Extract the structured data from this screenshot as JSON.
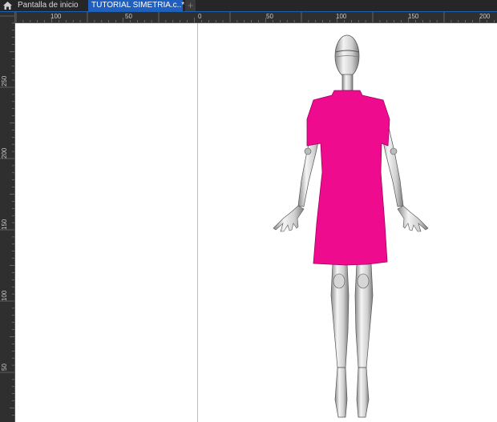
{
  "tabs": [
    {
      "label": "Pantalla de inicio",
      "active": false
    },
    {
      "label": "TUTORIAL SIMETRIA.c..*",
      "active": true
    }
  ],
  "tab_add_label": "+",
  "ruler": {
    "corner_glyph": "⇱",
    "horizontal_labels": [
      "100",
      "50",
      "0",
      "50",
      "100",
      "150",
      "200"
    ],
    "vertical_labels": [
      "250",
      "200",
      "150",
      "100",
      "50"
    ]
  },
  "colors": {
    "tab_active": "#1f5fbf",
    "dress": "#ee0b8e",
    "canvas": "#ffffff",
    "chrome": "#2b2b2b"
  },
  "icons": {
    "home": "home-icon",
    "add_tab": "plus-icon"
  }
}
